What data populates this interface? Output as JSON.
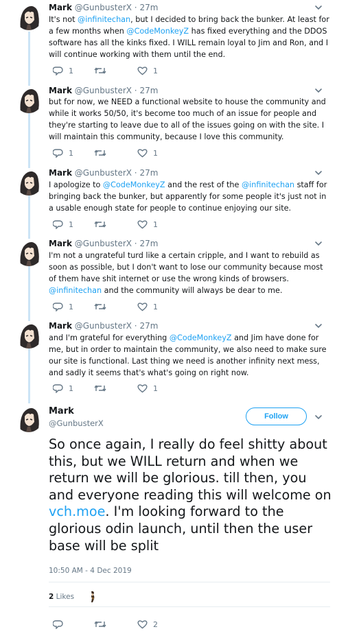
{
  "user": {
    "name": "Mark",
    "handle": "@GunbusterX"
  },
  "thread": [
    {
      "time": "27m",
      "segments": [
        {
          "t": "It's not "
        },
        {
          "t": "@infinitechan",
          "m": true
        },
        {
          "t": ", but I decided to bring back the bunker. At least for a few months when "
        },
        {
          "t": "@CodeMonkeyZ",
          "m": true
        },
        {
          "t": " has fixed everything and the DDOS software has all the kinks fixed. I WILL remain loyal to Jim and Ron, and I will continue working with them until the end."
        }
      ],
      "replies": "1",
      "retweets": "",
      "likes": "1"
    },
    {
      "time": "27m",
      "segments": [
        {
          "t": "but for now, we NEED a functional website to house the community and while it works 50/50, it's become too much of an issue for people and they're starting to leave due to all of the issues going on with the site. I will maintain this community, because I love this community."
        }
      ],
      "replies": "1",
      "retweets": "",
      "likes": "1"
    },
    {
      "time": "27m",
      "segments": [
        {
          "t": "I apologize to "
        },
        {
          "t": "@CodeMonkeyZ",
          "m": true
        },
        {
          "t": " and the rest of the "
        },
        {
          "t": "@infinitechan",
          "m": true
        },
        {
          "t": " staff for bringing back the bunker, but apparently for some people it's just not in a usable enough state for people to continue enjoying our site."
        }
      ],
      "replies": "1",
      "retweets": "",
      "likes": "1"
    },
    {
      "time": "27m",
      "segments": [
        {
          "t": "I'm not a ungrateful turd like a certain cripple, and I want to rebuild as soon as possible, but I don't want to lose our community because most of them have shit internet or use the wrong kinds of browsers. "
        },
        {
          "t": "@infinitechan",
          "m": true
        },
        {
          "t": " and the community will always be dear to me."
        }
      ],
      "replies": "1",
      "retweets": "",
      "likes": "1"
    },
    {
      "time": "27m",
      "segments": [
        {
          "t": "and I'm grateful for everything "
        },
        {
          "t": "@CodeMonkeyZ",
          "m": true
        },
        {
          "t": " and Jim have done for me, but in order to maintain the community, we also need to make sure our site is functional. Last thing we need is another infinity next mess, and sadly it seems that's what's going on right now."
        }
      ],
      "replies": "1",
      "retweets": "",
      "likes": "1"
    }
  ],
  "main": {
    "follow_label": "Follow",
    "segments": [
      {
        "t": "So once again, I really do feel shitty about this, but we WILL return and when we return we will be glorious. till then, you and everyone reading this will welcome on "
      },
      {
        "t": "vch.moe",
        "m": true
      },
      {
        "t": ". I'm looking forward to the glorious odin launch, until then the user base will be split"
      }
    ],
    "timestamp": "10:50 AM - 4 Dec 2019",
    "likes_count": "2",
    "likes_label": "Likes",
    "replies": "",
    "retweets": "",
    "likes": "2"
  },
  "colors": {
    "accent": "#1da1f2",
    "muted": "#657786",
    "thread_line": "#cce4f6"
  },
  "icons": [
    "reply-icon",
    "retweet-icon",
    "like-icon",
    "chevron-down-icon"
  ]
}
